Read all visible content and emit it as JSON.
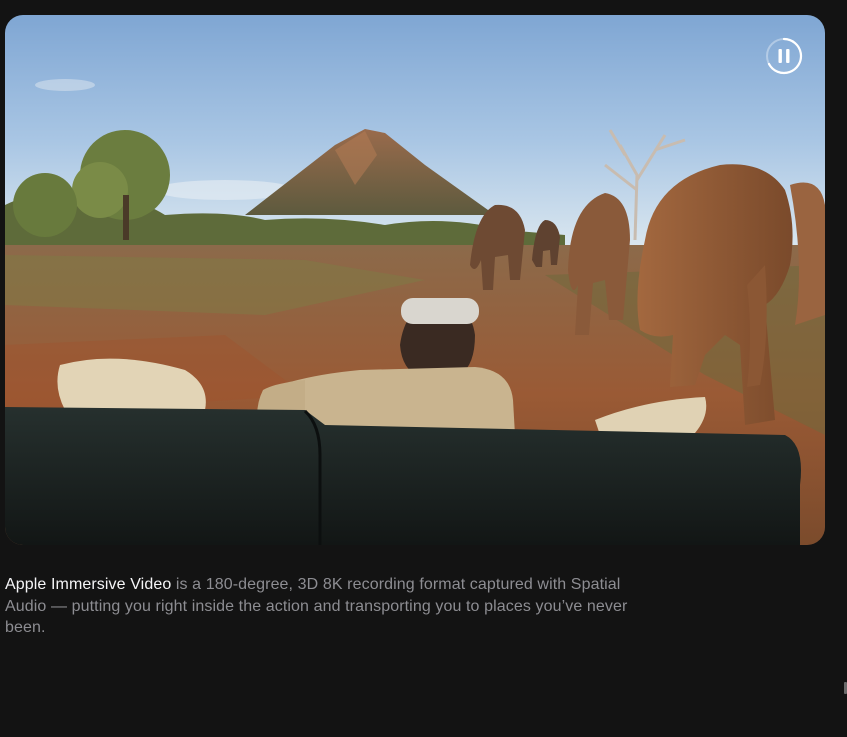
{
  "video": {
    "alt_subject": "immersive-safari-video",
    "state": "playing",
    "control_icon": "pause-icon",
    "progress_ring_fraction": 0.72
  },
  "caption": {
    "lead": "Apple Immersive Video",
    "body": " is a 180-degree, 3D 8K recording format captured with Spatial Audio — putting you right inside the action and transporting you to places you’ve never been."
  },
  "colors": {
    "background": "#131313",
    "caption_lead": "#f5f5f7",
    "caption_body": "#8d8d92"
  }
}
